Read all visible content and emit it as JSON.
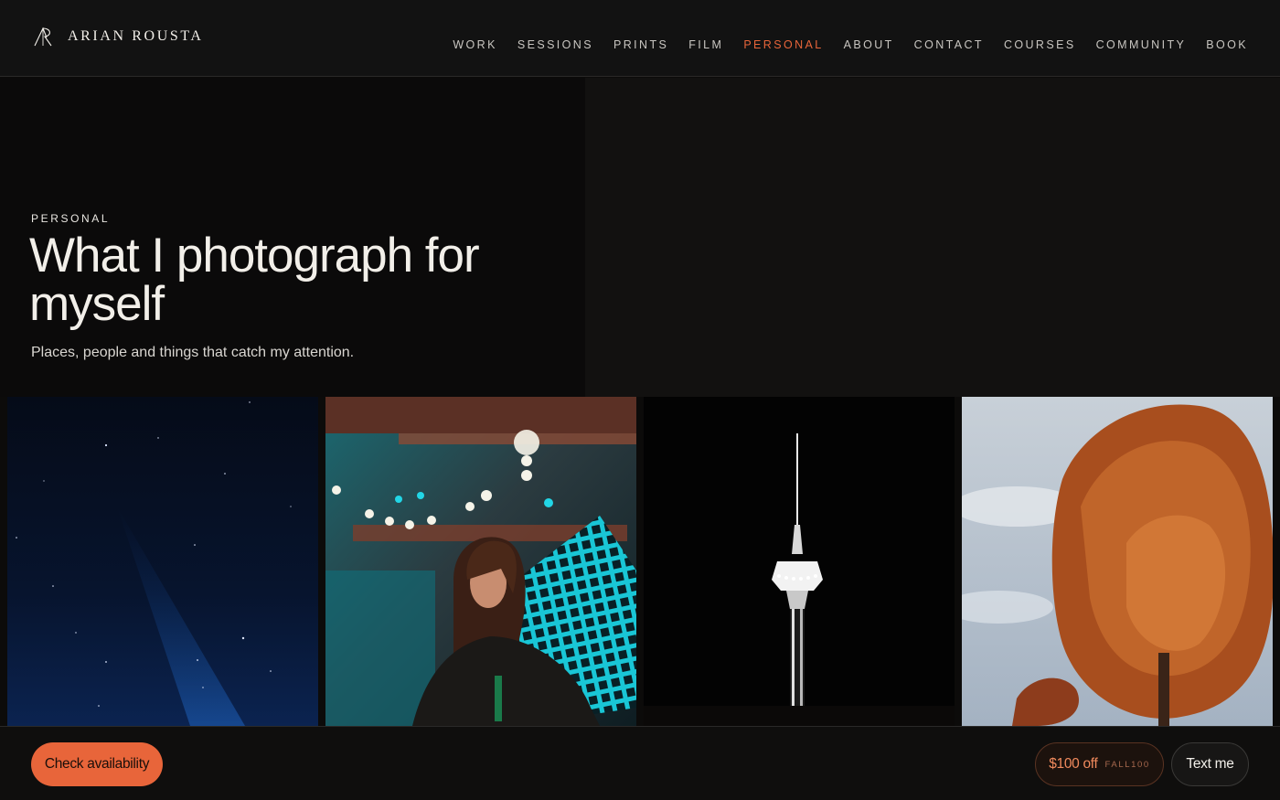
{
  "brand": {
    "name": "ARIAN ROUSTA",
    "logo_icon": "ar-monogram-icon"
  },
  "nav": {
    "items": [
      {
        "label": "WORK",
        "active": false
      },
      {
        "label": "SESSIONS",
        "active": false
      },
      {
        "label": "PRINTS",
        "active": false
      },
      {
        "label": "FILM",
        "active": false
      },
      {
        "label": "PERSONAL",
        "active": true
      },
      {
        "label": "ABOUT",
        "active": false
      },
      {
        "label": "CONTACT",
        "active": false
      },
      {
        "label": "COURSES",
        "active": false
      },
      {
        "label": "COMMUNITY",
        "active": false
      },
      {
        "label": "BOOK",
        "active": false
      }
    ]
  },
  "hero": {
    "eyebrow": "PERSONAL",
    "title": "What I photograph for myself",
    "subtitle": "Places, people and things that catch my attention."
  },
  "footer_bar": {
    "check_availability": "Check availability",
    "promo_label": "$100 off",
    "promo_code": "FALL100",
    "text_me": "Text me"
  },
  "colors": {
    "accent": "#e8653a",
    "background": "#0c0b0a",
    "header": "#121212",
    "text": "#e9e6e1"
  }
}
